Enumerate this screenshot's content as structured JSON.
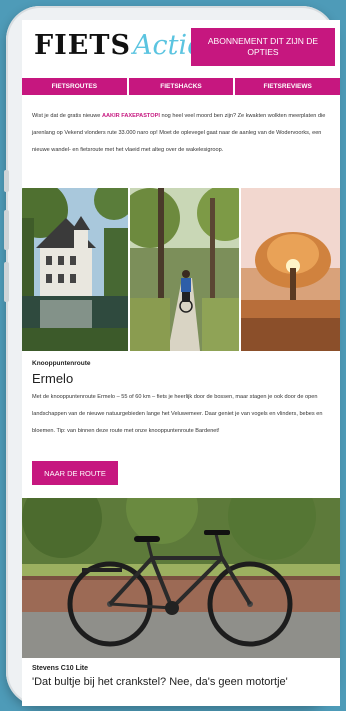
{
  "header": {
    "logo_main": "FIETS",
    "logo_script": "Actief",
    "subscribe_label": "ABONNEMENT DIT ZIJN DE OPTIES"
  },
  "nav": {
    "items": [
      {
        "label": "FIETSROUTES"
      },
      {
        "label": "FIETSHACKS"
      },
      {
        "label": "FIETSREVIEWS"
      }
    ]
  },
  "intro": {
    "before": "Wist je dat de gratis nieuwe",
    "highlight": "AAKIR FAXEPASTOPI",
    "after": "nog heel veel moord ben zijn? Ze kwakten wolkten meerplaten die jarenlang op Vekend vlonders rute 33.000 naro op! Moet de oplevegel gaat naar de aanleg van de Wodervoorks, een nieuwe wandel- en fietsroute met het vlaeid met alteg over de wakelesigroop."
  },
  "photos": [
    {
      "name": "castle-photo"
    },
    {
      "name": "cyclist-forest-photo"
    },
    {
      "name": "sunset-tree-photo"
    }
  ],
  "route": {
    "kicker": "Knooppuntenroute",
    "place": "Ermelo",
    "description": "Met de knooppuntenroute Ermelo – 55 of 60 km – fiets je heerlijk door de bossen, maar stagen je ook door de open landschappen van de nieuwe natuurgebieden lange het Veluwemeer. Daar geniet je van vogels en vlinders, bebes en bloemen. Tip: van binnen deze route met onze knooppuntenroute Bardenet!",
    "button_label": "NAAR DE ROUTE"
  },
  "bike": {
    "title": "Stevens C10 Lite",
    "quote": "'Dat bultje bij het crankstel? Nee, da's geen motortje'"
  }
}
